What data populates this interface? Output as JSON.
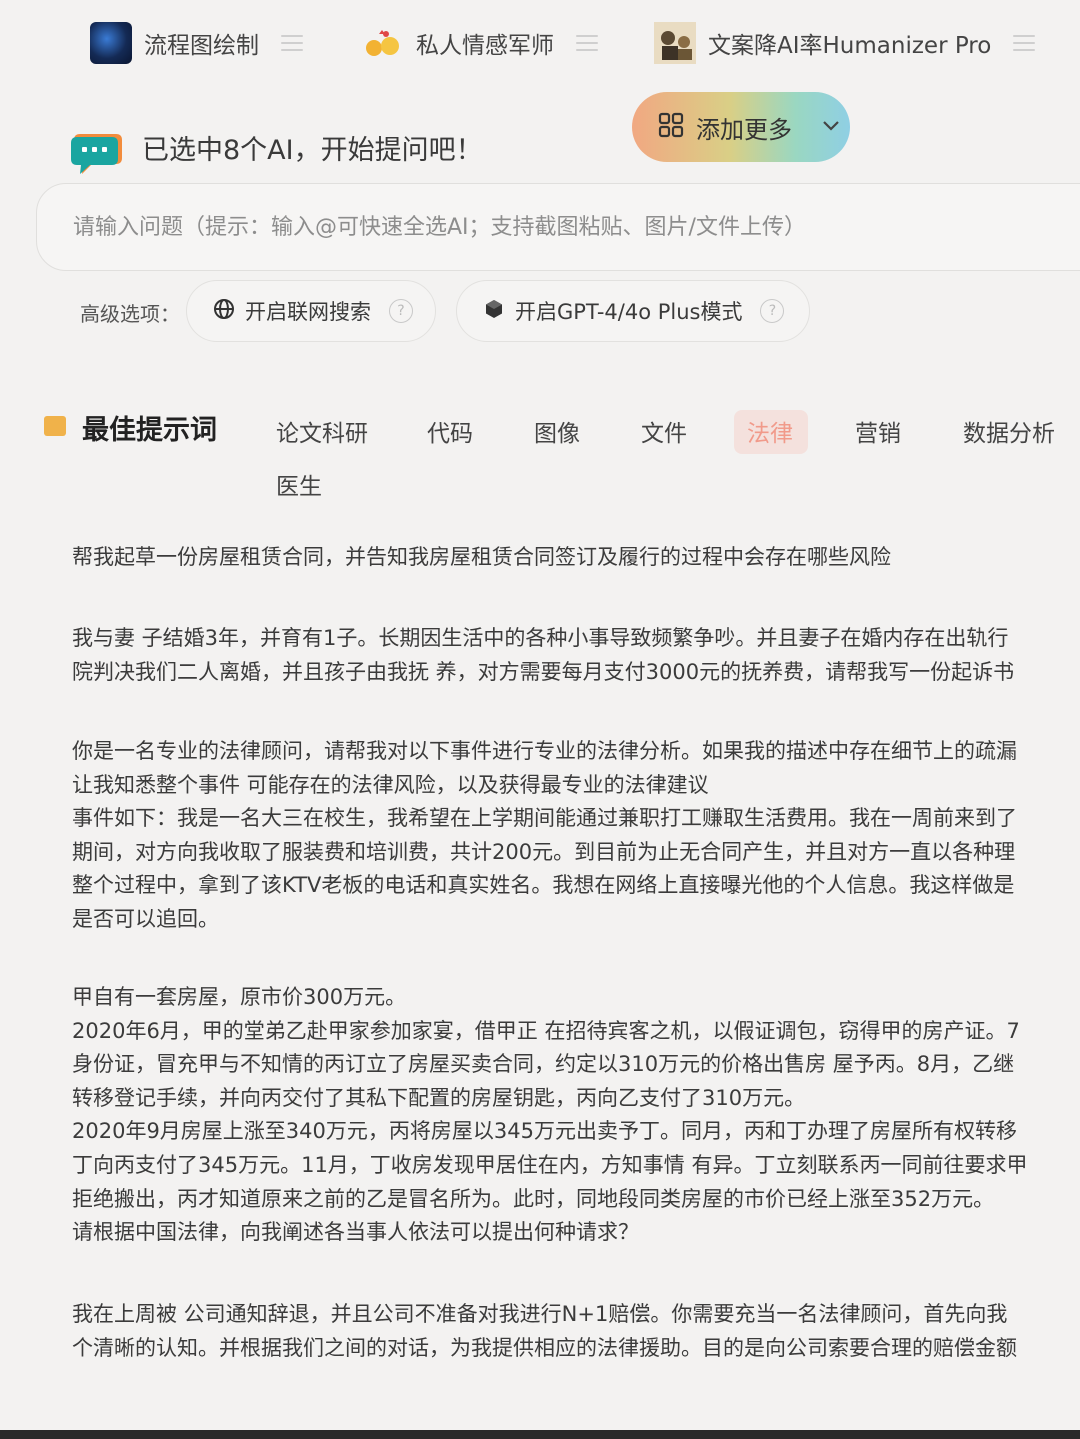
{
  "ai_chips": [
    {
      "name": "流程图绘制",
      "icon": "ai-avatar-icon"
    },
    {
      "name": "私人情感军师",
      "icon": "ai-avatar-icon"
    },
    {
      "name": "文案降AI率Humanizer Pro",
      "icon": "ai-avatar-icon"
    }
  ],
  "header": {
    "selected_text": "已选中8个AI，开始提问吧！",
    "add_more_label": "添加更多"
  },
  "input": {
    "placeholder": "请输入问题（提示：输入@可快速全选AI；支持截图粘贴、图片/文件上传）"
  },
  "advanced": {
    "label": "高级选项：",
    "web_search_label": "开启联网搜索",
    "gpt_plus_label": "开启GPT-4/4o Plus模式"
  },
  "prompts_section": {
    "title": "最佳提示词",
    "tabs": [
      "论文科研",
      "代码",
      "图像",
      "文件",
      "法律",
      "营销",
      "数据分析",
      "医生"
    ],
    "active_tab": "法律"
  },
  "prompts": [
    [
      "帮我起草一份房屋租赁合同，并告知我房屋租赁合同签订及履行的过程中会存在哪些风险"
    ],
    [
      "我与妻 子结婚3年，并育有1子。长期因生活中的各种小事导致频繁争吵。并且妻子在婚内存在出轨行",
      "院判决我们二人离婚，并且孩子由我抚 养，对方需要每月支付3000元的抚养费，请帮我写一份起诉书"
    ],
    [
      "你是一名专业的法律顾问，请帮我对以下事件进行专业的法律分析。如果我的描述中存在细节上的疏漏",
      "让我知悉整个事件 可能存在的法律风险，以及获得最专业的法律建议",
      "事件如下：我是一名大三在校生，我希望在上学期间能通过兼职打工赚取生活费用。我在一周前来到了",
      "期间，对方向我收取了服装费和培训费，共计200元。到目前为止无合同产生，并且对方一直以各种理",
      "整个过程中，拿到了该KTV老板的电话和真实姓名。我想在网络上直接曝光他的个人信息。我这样做是",
      "是否可以追回。"
    ],
    [
      "甲自有一套房屋，原市价300万元。",
      "2020年6月，甲的堂弟乙赴甲家参加家宴，借甲正 在招待宾客之机，以假证调包，窃得甲的房产证。7",
      "身份证，冒充甲与不知情的丙订立了房屋买卖合同，约定以310万元的价格出售房 屋予丙。8月，乙继",
      "转移登记手续，并向丙交付了其私下配置的房屋钥匙，丙向乙支付了310万元。",
      "2020年9月房屋上涨至340万元，丙将房屋以345万元出卖予丁。同月，丙和丁办理了房屋所有权转移",
      "丁向丙支付了345万元。11月，丁收房发现甲居住在内，方知事情 有异。丁立刻联系丙一同前往要求甲",
      "拒绝搬出，丙才知道原来之前的乙是冒名所为。此时，同地段同类房屋的市价已经上涨至352万元。",
      "请根据中国法律，向我阐述各当事人依法可以提出何种请求？"
    ],
    [
      "我在上周被 公司通知辞退，并且公司不准备对我进行N+1赔偿。你需要充当一名法律顾问，首先向我",
      "个清晰的认知。并根据我们之间的对话，为我提供相应的法律援助。目的是向公司索要合理的赔偿金额"
    ]
  ]
}
